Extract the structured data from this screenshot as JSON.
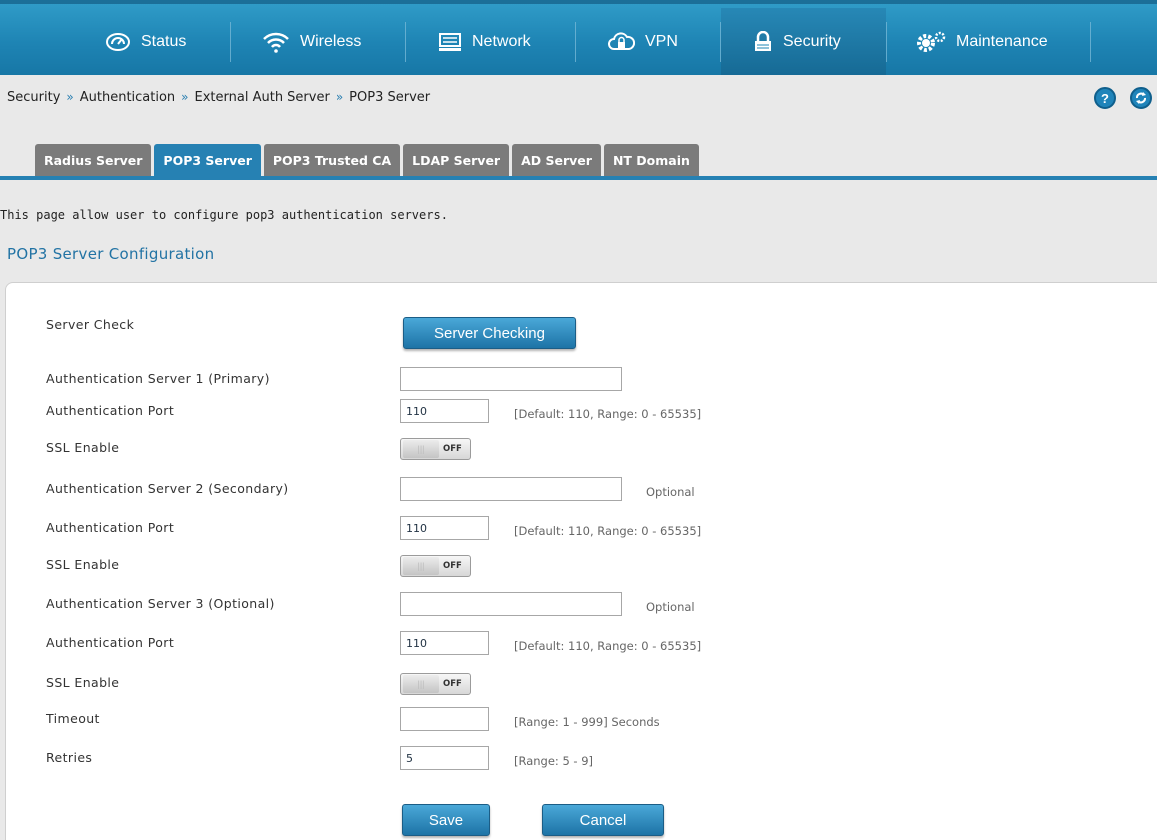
{
  "nav": {
    "tabs": [
      {
        "label": "Status",
        "icon": "dashboard-gauge-icon"
      },
      {
        "label": "Wireless",
        "icon": "wifi-icon"
      },
      {
        "label": "Network",
        "icon": "monitor-icon"
      },
      {
        "label": "VPN",
        "icon": "cloud-lock-icon"
      },
      {
        "label": "Security",
        "icon": "padlock-icon",
        "active": true
      },
      {
        "label": "Maintenance",
        "icon": "gears-icon"
      }
    ]
  },
  "breadcrumb": [
    "Security",
    "Authentication",
    "External Auth Server",
    "POP3 Server"
  ],
  "breadcrumb_separator": "»",
  "help_label": "?",
  "subtabs": [
    {
      "label": "Radius Server",
      "active": false
    },
    {
      "label": "POP3 Server",
      "active": true
    },
    {
      "label": "POP3 Trusted CA",
      "active": false
    },
    {
      "label": "LDAP Server",
      "active": false
    },
    {
      "label": "AD Server",
      "active": false
    },
    {
      "label": "NT Domain",
      "active": false
    }
  ],
  "description": "This page allow user to configure pop3 authentication servers.",
  "section_title": "POP3 Server Configuration",
  "form": {
    "server_check": {
      "label": "Server Check",
      "button": "Server Checking"
    },
    "server1": {
      "label": "Authentication Server 1 (Primary)",
      "value": ""
    },
    "port1": {
      "label": "Authentication Port",
      "value": "110",
      "hint": "[Default: 110, Range: 0 - 65535]"
    },
    "ssl1": {
      "label": "SSL Enable",
      "state": "OFF"
    },
    "server2": {
      "label": "Authentication Server 2 (Secondary)",
      "value": "",
      "hint": "Optional"
    },
    "port2": {
      "label": "Authentication Port",
      "value": "110",
      "hint": "[Default: 110, Range: 0 - 65535]"
    },
    "ssl2": {
      "label": "SSL Enable",
      "state": "OFF"
    },
    "server3": {
      "label": "Authentication Server 3 (Optional)",
      "value": "",
      "hint": "Optional"
    },
    "port3": {
      "label": "Authentication Port",
      "value": "110",
      "hint": "[Default: 110, Range: 0 - 65535]"
    },
    "ssl3": {
      "label": "SSL Enable",
      "state": "OFF"
    },
    "timeout": {
      "label": "Timeout",
      "value": "",
      "hint": "[Range: 1 - 999] Seconds"
    },
    "retries": {
      "label": "Retries",
      "value": "5",
      "hint": "[Range: 5 - 9]"
    }
  },
  "actions": {
    "save": "Save",
    "cancel": "Cancel"
  },
  "colors": {
    "nav": "#1e84b4",
    "accent": "#2681b3",
    "inactive_tab": "#7b7b7b"
  }
}
